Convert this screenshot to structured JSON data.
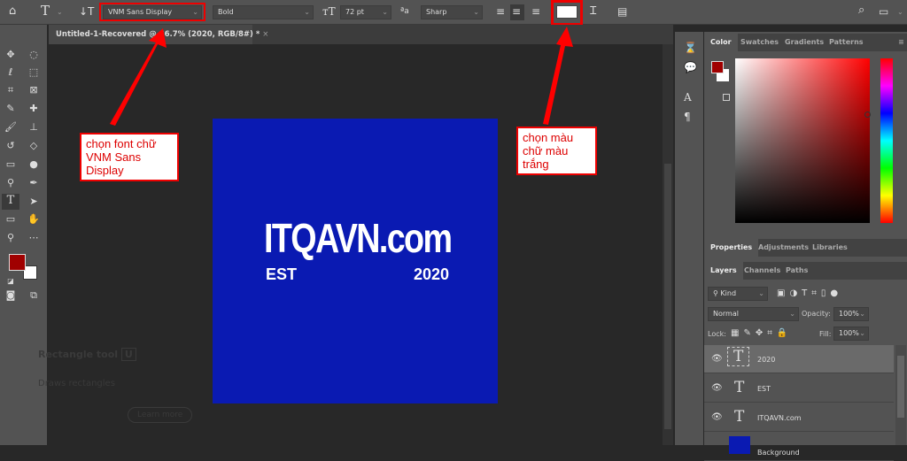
{
  "options_bar": {
    "font_family": "VNM Sans Display",
    "font_style": "Bold",
    "font_size": "72 pt",
    "antialias": "Sharp",
    "text_color": "#ffffff"
  },
  "document_tab": {
    "title": "Untitled-1-Recovered @ 66.7% (2020, RGB/8#) *",
    "close": "×"
  },
  "artwork": {
    "title": "ITQAVN.com",
    "left_text": "EST",
    "right_text": "2020",
    "background": "#0a1ab2"
  },
  "tooltip": {
    "title": "Rectangle tool",
    "shortcut": "U",
    "description": "Draws rectangles",
    "learn_more": "Learn more"
  },
  "annotations": {
    "font_note": "chọn font chữ VNM Sans Display",
    "color_note": "chọn màu chữ màu trắng",
    "color": "#e00000"
  },
  "color_panel": {
    "tabs": [
      "Color",
      "Swatches",
      "Gradients",
      "Patterns"
    ],
    "foreground": "#a00000",
    "background": "#ffffff"
  },
  "properties_panel": {
    "tabs": [
      "Properties",
      "Adjustments",
      "Libraries"
    ]
  },
  "layers_panel": {
    "tabs": [
      "Layers",
      "Channels",
      "Paths"
    ],
    "filter": "Kind",
    "blend_mode": "Normal",
    "opacity_label": "Opacity:",
    "opacity": "100%",
    "lock_label": "Lock:",
    "fill_label": "Fill:",
    "fill": "100%",
    "layers": [
      {
        "name": "2020",
        "selected": true
      },
      {
        "name": "EST"
      },
      {
        "name": "ITQAVN.com"
      },
      {
        "name": "Background"
      }
    ]
  }
}
